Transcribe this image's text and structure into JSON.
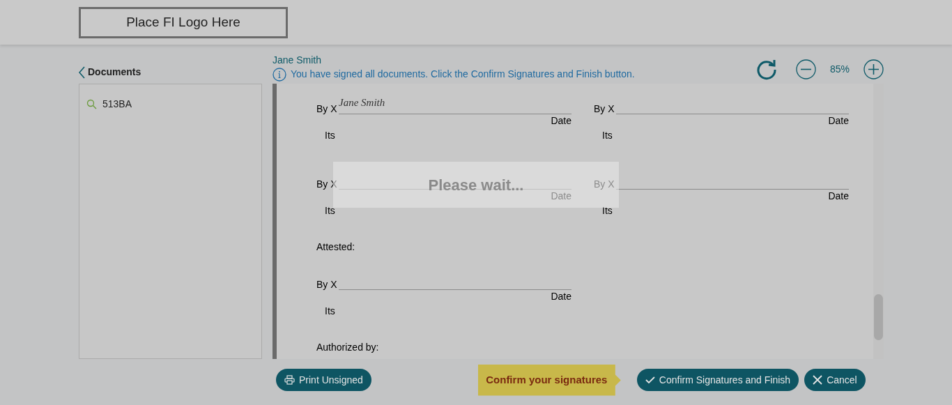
{
  "header": {
    "logo_text": "Place FI Logo Here"
  },
  "sidebar": {
    "title": "Documents",
    "items": [
      {
        "label": "513BA",
        "selected": false
      }
    ]
  },
  "viewer": {
    "signer": "Jane Smith",
    "notice": "You have signed all documents. Click the Confirm Signatures and Finish button.",
    "zoom": "85%"
  },
  "document": {
    "items": [
      {
        "kind": "pair",
        "blocks": [
          {
            "label": "By X",
            "signature": "Jane Smith",
            "date_label": "Date",
            "title_label": "Its"
          },
          {
            "label": "By X",
            "date_label": "Date",
            "title_label": "Its"
          }
        ]
      },
      {
        "kind": "pair",
        "blocks": [
          {
            "label": "By X",
            "date_label": "Date",
            "title_label": "Its"
          },
          {
            "label": "By X",
            "date_label": "Date",
            "title_label": "Its"
          }
        ]
      },
      {
        "kind": "heading",
        "text": "Attested:"
      },
      {
        "kind": "pair",
        "blocks": [
          {
            "label": "By X",
            "date_label": "Date",
            "title_label": "Its"
          }
        ]
      },
      {
        "kind": "heading",
        "text": "Authorized by:"
      }
    ]
  },
  "loading": {
    "text": "Please wait..."
  },
  "footer": {
    "print_button": "Print Unsigned",
    "tooltip": "Confirm your signatures",
    "confirm_button": "Confirm Signatures and Finish",
    "cancel_button": "Cancel"
  }
}
